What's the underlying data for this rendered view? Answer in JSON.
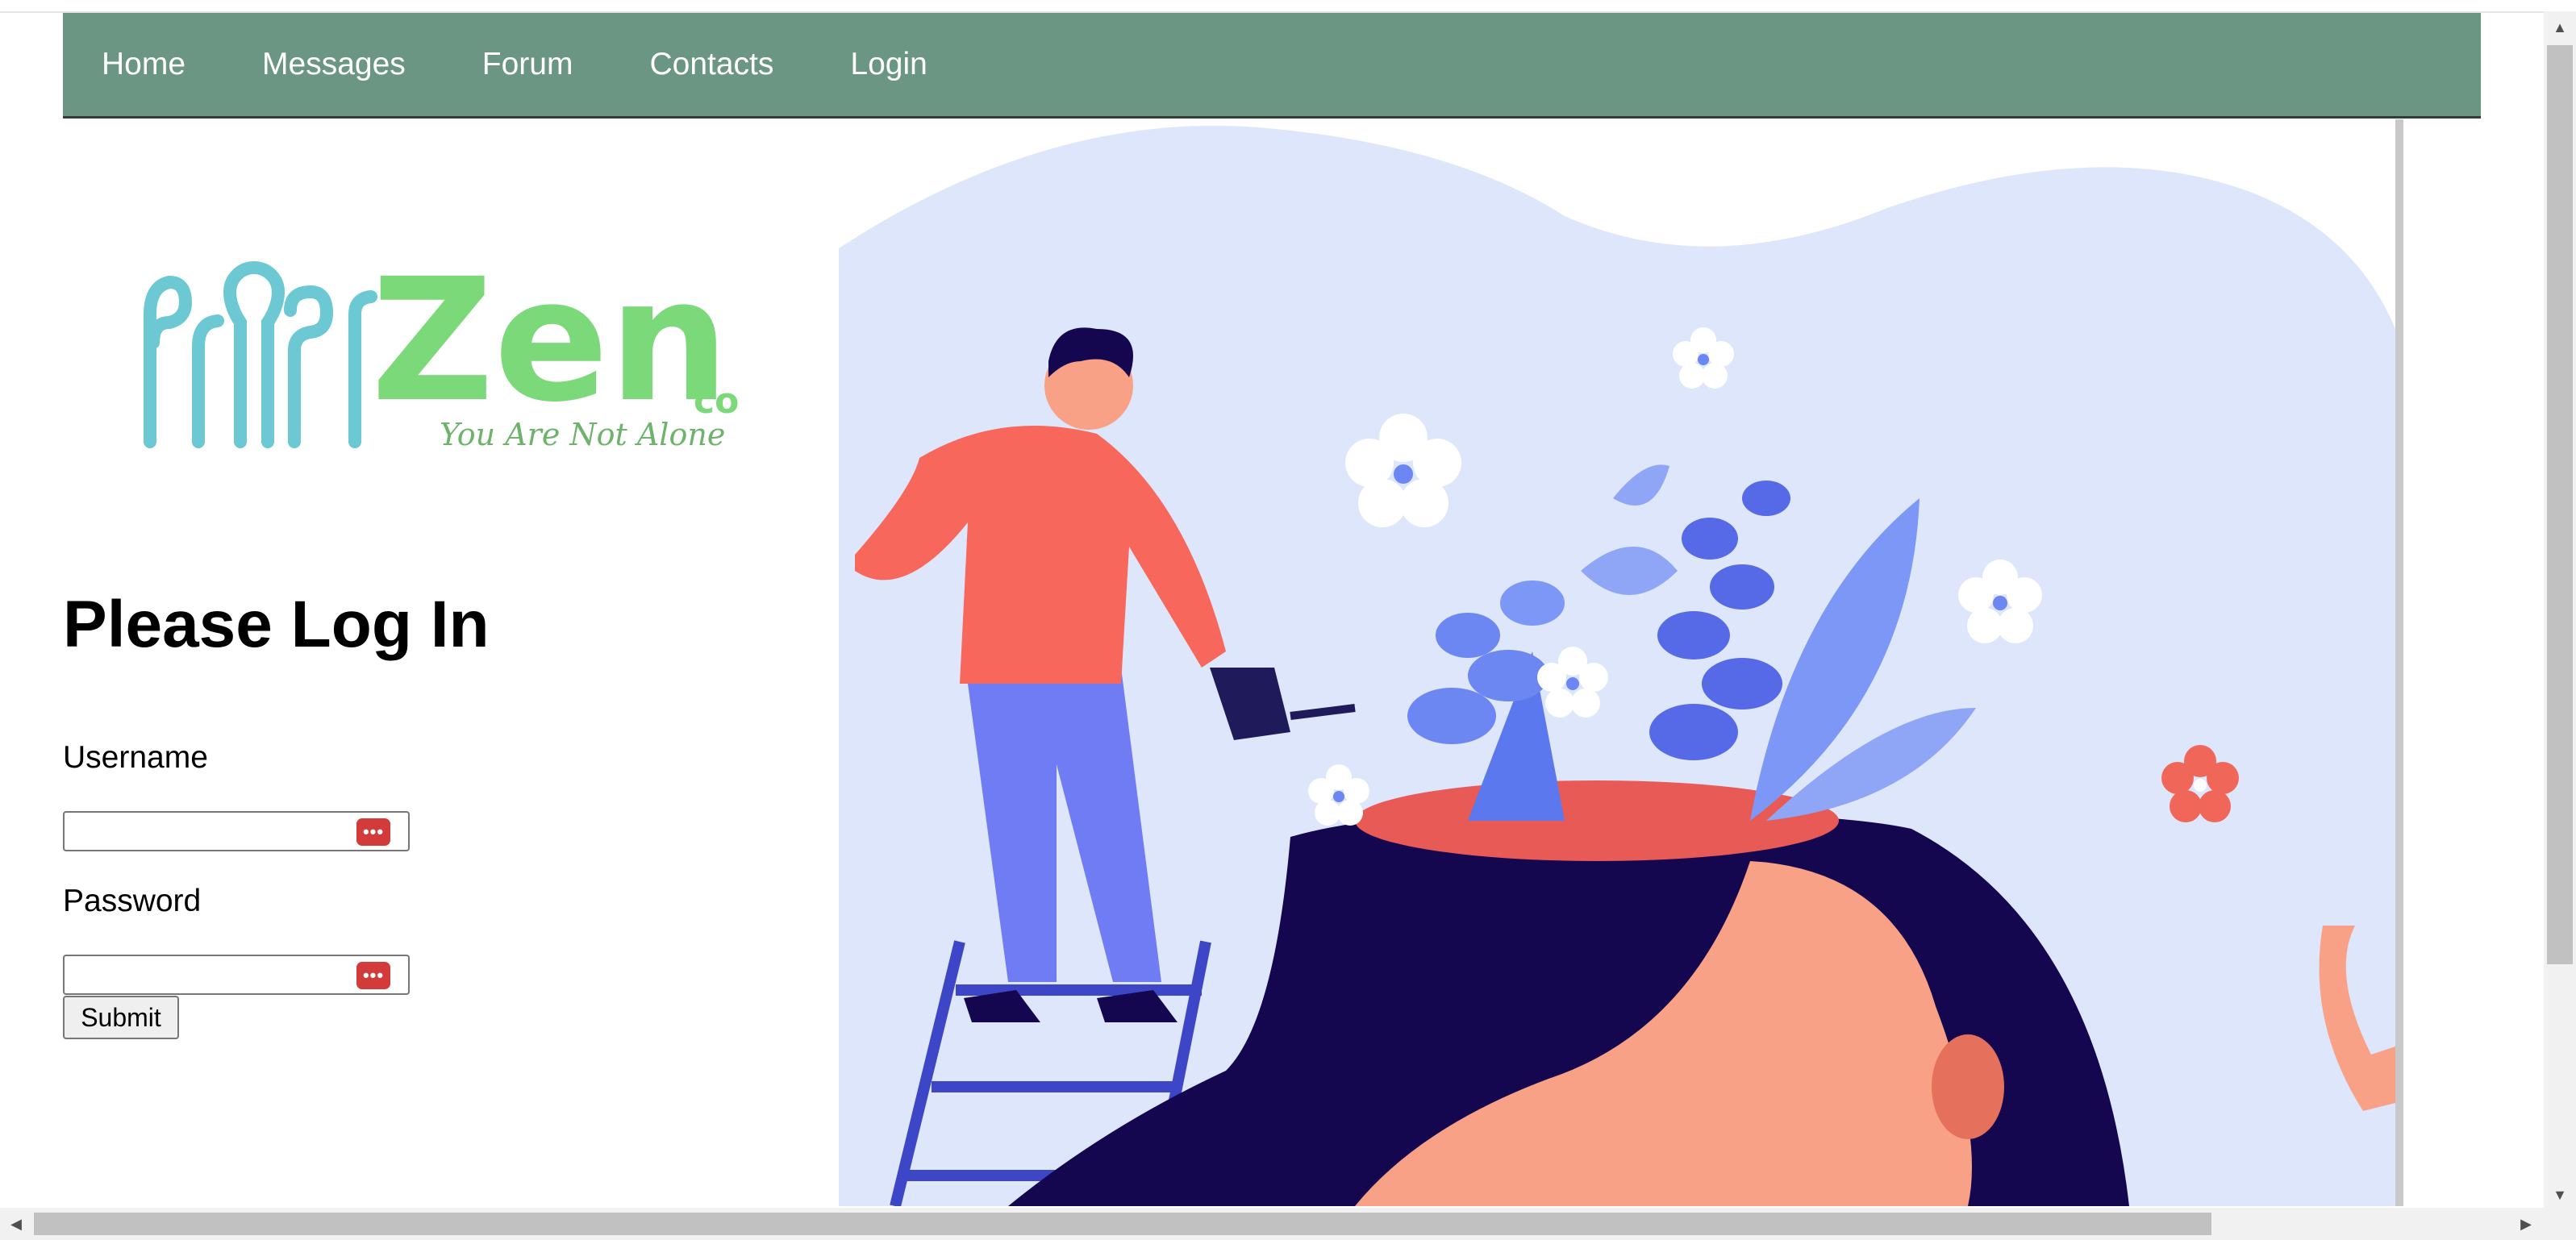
{
  "nav": {
    "items": [
      {
        "label": "Home"
      },
      {
        "label": "Messages"
      },
      {
        "label": "Forum"
      },
      {
        "label": "Contacts"
      },
      {
        "label": "Login"
      }
    ]
  },
  "logo": {
    "text": "Zen",
    "suffix": "co",
    "tagline": "You Are Not Alone",
    "colors": {
      "figures": "#6cc9d3",
      "text": "#7cd97a"
    }
  },
  "login": {
    "heading": "Please Log In",
    "username_label": "Username",
    "username_value": "",
    "password_label": "Password",
    "password_value": "",
    "submit_label": "Submit",
    "password_manager_icon": "key-dots-icon"
  },
  "colors": {
    "nav_bg": "#6b9683",
    "hero_bg": "#dde6fb",
    "accent_red": "#f0675a",
    "dark_navy": "#14064f",
    "leaf_blue": "#6c86f2"
  }
}
